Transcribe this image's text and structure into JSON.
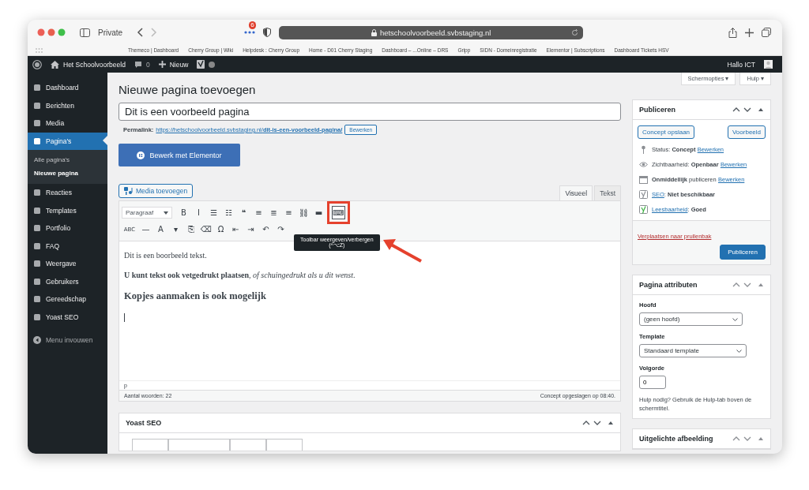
{
  "browser": {
    "profile": "Private",
    "tracker_count": "6",
    "url": "hetschoolvoorbeeld.svbstaging.nl"
  },
  "bookmarks": [
    "Themeco | Dashboard",
    "Cherry Group | Wiki",
    "Helpdesk : Cherry Group",
    "Home - D01 Cherry Staging",
    "Dashboard – ...Online – DRS",
    "Gripp",
    "SIDN - Domeinregistratie",
    "Elementor | Subscriptions",
    "Dashboard Tickets HSV"
  ],
  "admin_bar": {
    "site": "Het Schoolvoorbeeld",
    "comments": "0",
    "new": "Nieuw",
    "greeting": "Hallo ICT"
  },
  "sidebar": {
    "items": [
      {
        "label": "Dashboard",
        "selected": false
      },
      {
        "label": "Berichten",
        "selected": false
      },
      {
        "label": "Media",
        "selected": false
      },
      {
        "label": "Pagina's",
        "selected": true,
        "children": [
          {
            "label": "Alle pagina's",
            "selected": false
          },
          {
            "label": "Nieuwe pagina",
            "selected": true
          }
        ]
      },
      {
        "label": "Reacties",
        "selected": false
      },
      {
        "label": "Templates",
        "selected": false
      },
      {
        "label": "Portfolio",
        "selected": false
      },
      {
        "label": "FAQ",
        "selected": false
      },
      {
        "label": "Weergave",
        "selected": false
      },
      {
        "label": "Gebruikers",
        "selected": false
      },
      {
        "label": "Gereedschap",
        "selected": false
      },
      {
        "label": "Yoast SEO",
        "selected": false
      }
    ],
    "collapse": "Menu invouwen"
  },
  "screen_buttons": [
    "Schermopties ▾",
    "Hulp ▾"
  ],
  "page_title": "Nieuwe pagina toevoegen",
  "title_field": {
    "value": "Dit is een voorbeeld pagina"
  },
  "permalink": {
    "label": "Permalink:",
    "url": "https://hetschoolvoorbeeld.svbstaging.nl/**dit-is-een-voorbeeld-pagina/**",
    "button": "Bewerken"
  },
  "elementor_button": "Bewerk met Elementor",
  "media_button": "Media toevoegen",
  "editor_tabs": [
    {
      "label": "Visueel",
      "selected": true
    },
    {
      "label": "Tekst",
      "selected": false
    }
  ],
  "toolbar": {
    "format": "Paragraaf",
    "row1": [
      {
        "glyph": "B",
        "highlighted": false
      },
      {
        "glyph": "I",
        "highlighted": false
      },
      {
        "glyph": "☰",
        "highlighted": false
      },
      {
        "glyph": "☷",
        "highlighted": false
      },
      {
        "glyph": "❝",
        "highlighted": false
      },
      {
        "glyph": "≡",
        "highlighted": false
      },
      {
        "glyph": "≣",
        "highlighted": false
      },
      {
        "glyph": "≡",
        "highlighted": false
      },
      {
        "glyph": "⛓",
        "highlighted": false
      },
      {
        "glyph": "▬",
        "highlighted": false
      },
      {
        "glyph": "⌨",
        "highlighted": true
      }
    ],
    "row2": [
      {
        "glyph": "ABC",
        "highlighted": false
      },
      {
        "glyph": "—",
        "highlighted": false
      },
      {
        "glyph": "A",
        "highlighted": false
      },
      {
        "glyph": "▾",
        "highlighted": false
      },
      {
        "glyph": "⎘",
        "highlighted": false
      },
      {
        "glyph": "⌫",
        "highlighted": false
      },
      {
        "glyph": "Ω",
        "highlighted": false
      },
      {
        "glyph": "⇤",
        "highlighted": false
      },
      {
        "glyph": "⇥",
        "highlighted": false
      },
      {
        "glyph": "↶",
        "highlighted": false
      },
      {
        "glyph": "↷",
        "highlighted": false
      }
    ]
  },
  "tooltip": {
    "text": "Toolbar weergeven/verbergen",
    "shortcut": "(^⌥Z)"
  },
  "content": [
    {
      "kind": "paragraph",
      "text": "Dit is een boorbeeld tekst."
    },
    {
      "kind": "paragraph",
      "text": "**U kunt tekst ook vetgedrukt plaatsen**, *of schuingedrukt als u dit wenst*."
    },
    {
      "kind": "heading",
      "text": "Kopjes aanmaken is ook mogelijk"
    }
  ],
  "path": "p",
  "word_count": "Aantal woorden: 22",
  "saved": "Concept opgeslagen op 08:40.",
  "yoast_box": {
    "title": "Yoast SEO"
  },
  "publish": {
    "title": "Publiceren",
    "save": "Concept opslaan",
    "preview": "Voorbeeld",
    "rows": [
      {
        "parts": [
          {
            "kind": "text",
            "text": "Status: "
          },
          {
            "kind": "bold",
            "text": "Concept"
          },
          {
            "kind": "link",
            "text": "Bewerken"
          }
        ]
      },
      {
        "parts": [
          {
            "kind": "text",
            "text": "Zichtbaarheid: "
          },
          {
            "kind": "bold",
            "text": "Openbaar"
          },
          {
            "kind": "link",
            "text": "Bewerken"
          }
        ]
      },
      {
        "parts": [
          {
            "kind": "bold",
            "text": "Onmiddellijk"
          },
          {
            "kind": "text",
            "text": " publiceren"
          },
          {
            "kind": "link",
            "text": "Bewerken"
          }
        ]
      },
      {
        "parts": [
          {
            "kind": "link",
            "text": "SEO"
          },
          {
            "kind": "text",
            "text": ": "
          },
          {
            "kind": "bold",
            "text": "Niet beschikbaar"
          }
        ]
      },
      {
        "parts": [
          {
            "kind": "link",
            "text": "Leesbaarheid"
          },
          {
            "kind": "text",
            "text": ": "
          },
          {
            "kind": "bold",
            "text": "Goed"
          }
        ]
      }
    ],
    "trash": "Verplaatsen naar prullenbak",
    "publish_button": "Publiceren"
  },
  "attributes": {
    "title": "Pagina attributen",
    "parent_label": "Hoofd",
    "parent_value": "(geen hoofd)",
    "template_label": "Template",
    "template_value": "Standaard template",
    "order_label": "Volgorde",
    "order_value": "0",
    "help": "Hulp nodig? Gebruik de Hulp-tab boven de schermtitel."
  },
  "featured_box": {
    "title": "Uitgelichte afbeelding"
  }
}
